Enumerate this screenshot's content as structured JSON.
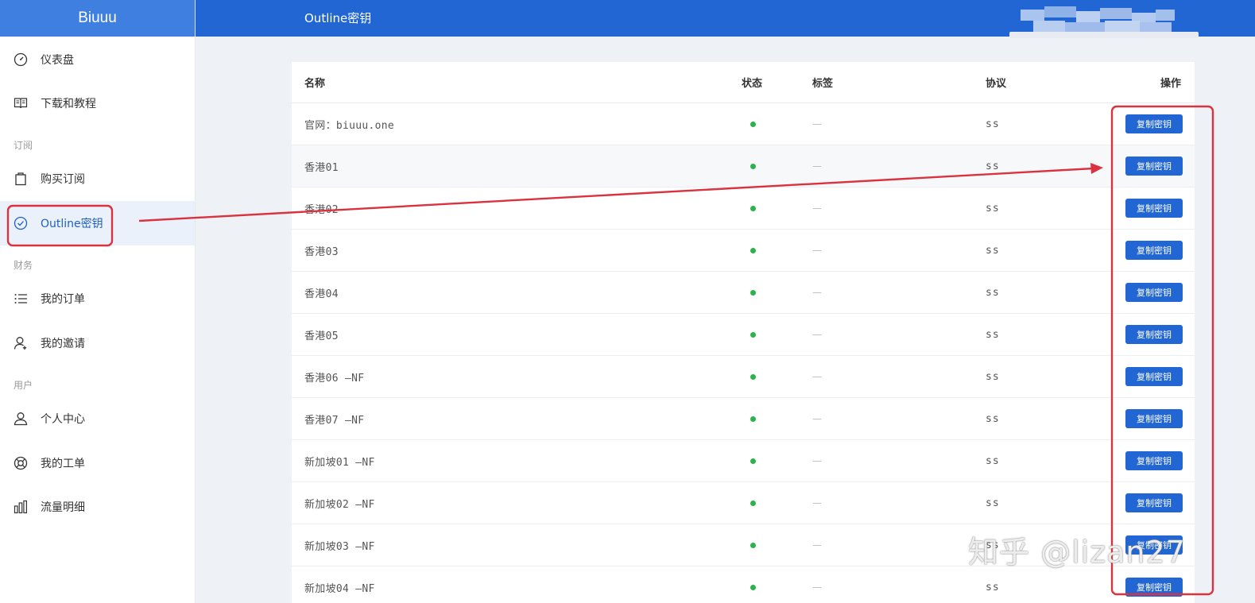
{
  "app": {
    "brand": "Biuuu"
  },
  "header": {
    "title": "Outline密钥"
  },
  "sidebar": {
    "items": [
      {
        "label": "仪表盘",
        "icon": "dashboard-icon"
      },
      {
        "label": "下载和教程",
        "icon": "book-icon"
      },
      {
        "label": "购买订阅",
        "icon": "bag-icon"
      },
      {
        "label": "Outline密钥",
        "icon": "check-circle-icon",
        "active": true
      },
      {
        "label": "我的订单",
        "icon": "list-icon"
      },
      {
        "label": "我的邀请",
        "icon": "user-add-icon"
      },
      {
        "label": "个人中心",
        "icon": "user-icon"
      },
      {
        "label": "我的工单",
        "icon": "lifebuoy-icon"
      },
      {
        "label": "流量明细",
        "icon": "bar-chart-icon"
      }
    ],
    "groups": [
      "订阅",
      "财务",
      "用户"
    ]
  },
  "table": {
    "columns": [
      "名称",
      "状态",
      "标签",
      "协议",
      "操作"
    ],
    "rows": [
      {
        "name": "官网：biuuu.one",
        "tag": "—",
        "protocol": "ss",
        "action": "复制密钥"
      },
      {
        "name": "香港01",
        "tag": "—",
        "protocol": "ss",
        "action": "复制密钥"
      },
      {
        "name": "香港02",
        "tag": "—",
        "protocol": "ss",
        "action": "复制密钥"
      },
      {
        "name": "香港03",
        "tag": "—",
        "protocol": "ss",
        "action": "复制密钥"
      },
      {
        "name": "香港04",
        "tag": "—",
        "protocol": "ss",
        "action": "复制密钥"
      },
      {
        "name": "香港05",
        "tag": "—",
        "protocol": "ss",
        "action": "复制密钥"
      },
      {
        "name": "香港06 —NF",
        "tag": "—",
        "protocol": "ss",
        "action": "复制密钥"
      },
      {
        "name": "香港07 —NF",
        "tag": "—",
        "protocol": "ss",
        "action": "复制密钥"
      },
      {
        "name": "新加坡01 —NF",
        "tag": "—",
        "protocol": "ss",
        "action": "复制密钥"
      },
      {
        "name": "新加坡02 —NF",
        "tag": "—",
        "protocol": "ss",
        "action": "复制密钥"
      },
      {
        "name": "新加坡03 —NF",
        "tag": "—",
        "protocol": "ss",
        "action": "复制密钥"
      },
      {
        "name": "新加坡04 —NF",
        "tag": "—",
        "protocol": "ss",
        "action": "复制密钥"
      }
    ]
  },
  "watermark": "知乎 @lizan27",
  "colors": {
    "header": "#2266d3",
    "brand": "#3f7fe0",
    "status_online": "#2bb24c",
    "annotation": "#d9333f",
    "button": "#2266d3"
  }
}
